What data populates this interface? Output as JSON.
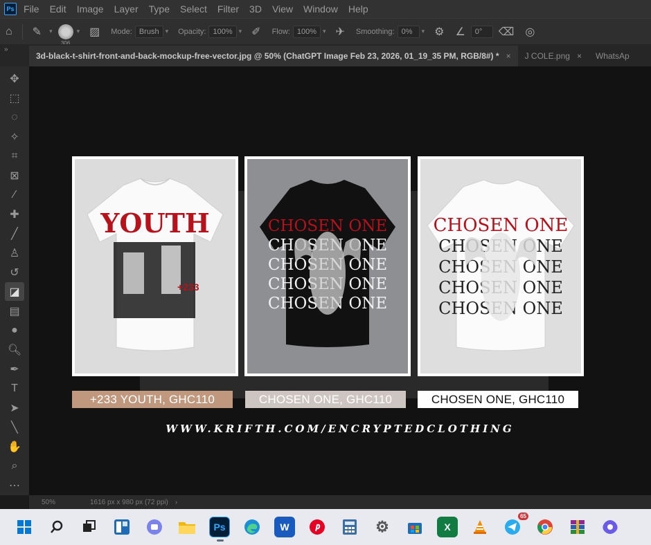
{
  "app": {
    "logo": "Ps"
  },
  "menu": [
    "File",
    "Edit",
    "Image",
    "Layer",
    "Type",
    "Select",
    "Filter",
    "3D",
    "View",
    "Window",
    "Help"
  ],
  "options": {
    "brush_size": "306",
    "mode_label": "Mode:",
    "mode_value": "Brush",
    "opacity_label": "Opacity:",
    "opacity_value": "100%",
    "flow_label": "Flow:",
    "flow_value": "100%",
    "smoothing_label": "Smoothing:",
    "smoothing_value": "0%",
    "angle_value": "0°"
  },
  "tabs": [
    {
      "label": "3d-black-t-shirt-front-and-back-mockup-free-vector.jpg @ 50% (ChatGPT Image Feb 23, 2026, 01_19_35 PM, RGB/8#) *",
      "close": "×"
    },
    {
      "label": "J COLE.png",
      "close": "×"
    },
    {
      "label": "WhatsAp",
      "close": ""
    }
  ],
  "canvas": {
    "cards": [
      {
        "shirt_text": "YOUTH",
        "small_text": "+233",
        "shirt_color": "#ffffff",
        "bg": "#dcdcdc"
      },
      {
        "shirt_text": "CHOSEN ONE",
        "repeat_text": "CHOSEN ONE",
        "shirt_color": "#111111",
        "bg": "#8e8f93"
      },
      {
        "shirt_text": "CHOSEN ONE",
        "repeat_text": "CHOSEN ONE",
        "shirt_color": "#ffffff",
        "bg": "#dedede"
      }
    ],
    "prices": [
      "+233 YOUTH, GHC110",
      "CHOSEN ONE, GHC110",
      "CHOSEN ONE, GHC110"
    ],
    "url": "WWW.KRIFTH.COM/ENCRYPTEDCLOTHING"
  },
  "status": {
    "zoom": "50%",
    "dimensions": "1616 px x 980 px (72 ppi)",
    "arrow": "›"
  },
  "taskbar": {
    "icons": [
      "windows-start-icon",
      "search-icon",
      "task-view-icon",
      "widgets-icon",
      "teams-icon",
      "file-explorer-icon",
      "photoshop-icon",
      "edge-icon",
      "word-icon",
      "pinterest-icon",
      "calculator-icon",
      "settings-icon",
      "store-icon",
      "excel-icon",
      "vlc-icon",
      "telegram-icon",
      "chrome-icon",
      "winrar-icon",
      "copilot-icon"
    ],
    "telegram_badge": "65",
    "ps_label": "Ps",
    "word_label": "W",
    "excel_label": "X"
  },
  "colors": {
    "accent_red": "#b5121b",
    "price1_bg": "#c0987e",
    "price2_bg": "#cdc5c1"
  }
}
